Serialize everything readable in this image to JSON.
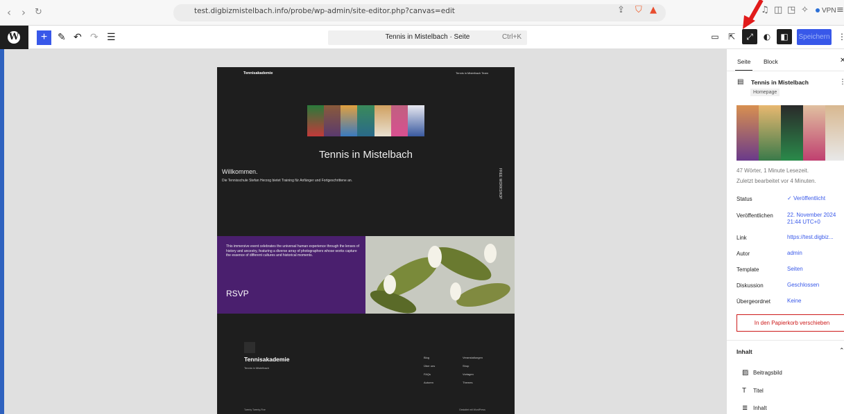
{
  "browser": {
    "url": "test.digbizmistelbach.info/probe/wp-admin/site-editor.php?canvas=edit",
    "vpn_label": "VPN"
  },
  "toolbar": {
    "document_title": "Tennis in Mistelbach · Seite",
    "shortcut": "Ctrl+K",
    "save_label": "Speichern"
  },
  "preview": {
    "site_title": "Tennisakademie",
    "nav_items": "Tennis in Mistelbach    Team",
    "page_title": "Tennis in Mistelbach",
    "welcome_heading": "Willkommen.",
    "welcome_text": "Die Tennisschule Stefan Herzog bietet Training für Anfänger und Fortgeschrittene an.",
    "vertical_text": "FREE WORKSHOP",
    "event_text": "This immersive event celebrates the universal human experience through the lenses of history and ancestry, featuring a diverse array of photographers whose works capture the essence of different cultures and historical moments.",
    "rsvp": "RSVP",
    "footer_name": "Tennisakademie",
    "footer_sub": "Tennis in Mistelbach",
    "footer_col1": [
      "Blog",
      "Über uns",
      "FAQs",
      "Autoren"
    ],
    "footer_col2": [
      "Veranstaltungen",
      "Shop",
      "Vorlagen",
      "Themes"
    ],
    "footer_left": "Twenty Twenty-Five",
    "footer_right": "Gestaltet mit WordPress"
  },
  "sidebar": {
    "tabs": [
      "Seite",
      "Block"
    ],
    "page_title": "Tennis in Mistelbach",
    "page_badge": "Homepage",
    "meta_words": "47 Wörter, 1 Minute Lesezeit.",
    "meta_edited": "Zuletzt bearbeitet vor 4 Minuten.",
    "rows": [
      {
        "label": "Status",
        "value": "Veröffentlicht"
      },
      {
        "label": "Veröffentlichen",
        "value": "22. November 2024 21:44 UTC+0"
      },
      {
        "label": "Link",
        "value": "https://test.digbiz..."
      },
      {
        "label": "Autor",
        "value": "admin"
      },
      {
        "label": "Template",
        "value": "Seiten"
      },
      {
        "label": "Diskussion",
        "value": "Geschlossen"
      },
      {
        "label": "Übergeordnet",
        "value": "Keine"
      }
    ],
    "trash": "In den Papierkorb verschieben",
    "content_heading": "Inhalt",
    "content_items": [
      "Beitragsbild",
      "Titel",
      "Inhalt"
    ]
  },
  "colors": {
    "accent": "#3858e9",
    "purple": "#4a1f6e",
    "danger": "#cc1818"
  }
}
